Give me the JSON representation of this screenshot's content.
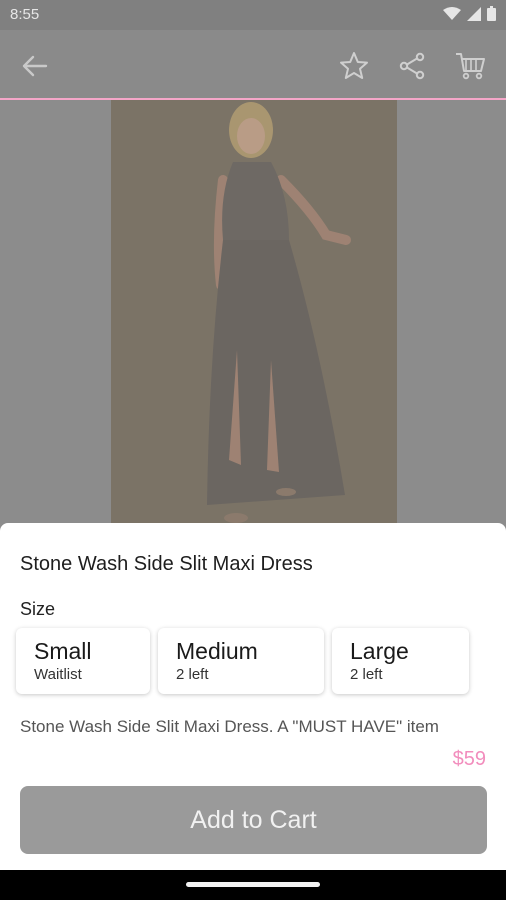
{
  "status_bar": {
    "time": "8:55"
  },
  "appbar": {
    "icons": [
      "back-arrow-icon",
      "star-icon",
      "share-icon",
      "cart-icon"
    ],
    "accent_color": "#f4a6c8"
  },
  "product": {
    "title": "Stone Wash Side Slit Maxi Dress",
    "size_label": "Size",
    "sizes": [
      {
        "name": "Small",
        "status": "Waitlist"
      },
      {
        "name": "Medium",
        "status": "2 left"
      },
      {
        "name": "Large",
        "status": "2 left"
      }
    ],
    "description": "Stone Wash Side Slit Maxi Dress. A \"MUST HAVE\" item",
    "price": "$59",
    "price_color": "#f28dbd"
  },
  "cta": {
    "label": "Add to Cart"
  }
}
